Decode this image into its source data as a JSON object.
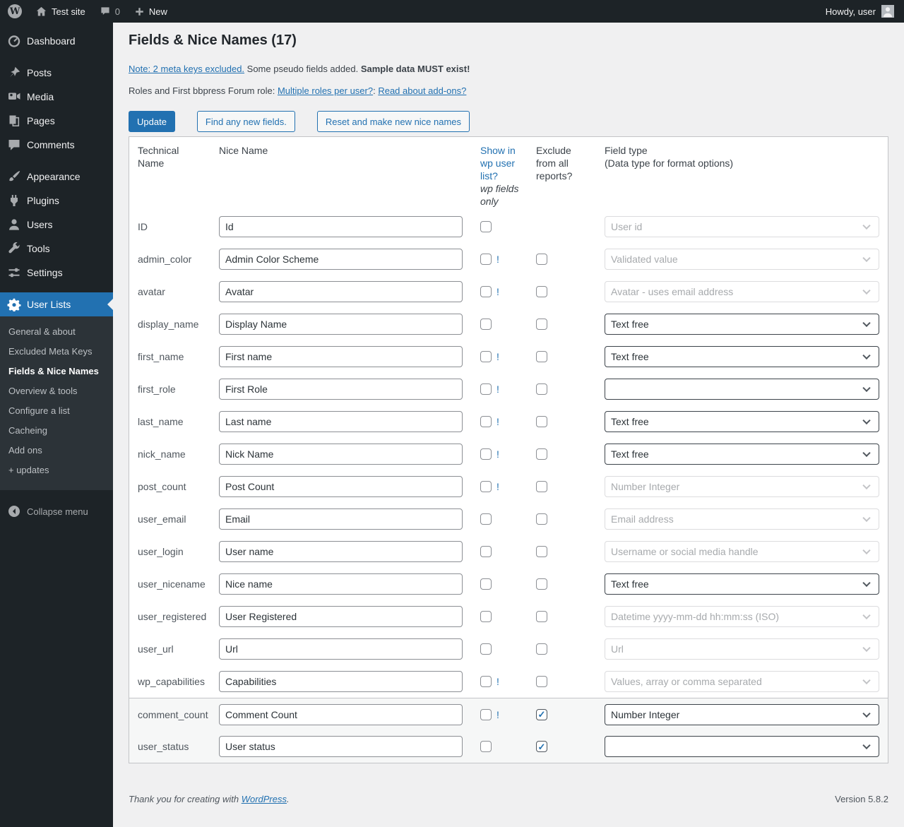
{
  "colors": {
    "accent": "#2271b1",
    "sidebar_bg": "#1d2327",
    "submenu_bg": "#2c3338",
    "content_bg": "#f0f0f1",
    "card_border": "#c3c4c7",
    "highlight_row": "#f6f7f7"
  },
  "admin_bar": {
    "site_name": "Test site",
    "comment_count": "0",
    "new_label": "New",
    "howdy": "Howdy, user",
    "logo_letter": "W"
  },
  "sidebar": {
    "items": [
      {
        "label": "Dashboard",
        "icon": "dashboard-icon",
        "group_break": false
      },
      {
        "label": "Posts",
        "icon": "pin-icon",
        "group_break": true
      },
      {
        "label": "Media",
        "icon": "media-icon",
        "group_break": false
      },
      {
        "label": "Pages",
        "icon": "pages-icon",
        "group_break": false
      },
      {
        "label": "Comments",
        "icon": "comment-icon",
        "group_break": false
      },
      {
        "label": "Appearance",
        "icon": "brush-icon",
        "group_break": true
      },
      {
        "label": "Plugins",
        "icon": "plug-icon",
        "group_break": false
      },
      {
        "label": "Users",
        "icon": "user-icon",
        "group_break": false
      },
      {
        "label": "Tools",
        "icon": "wrench-icon",
        "group_break": false
      },
      {
        "label": "Settings",
        "icon": "sliders-icon",
        "group_break": false
      },
      {
        "label": "User Lists",
        "icon": "gear-icon",
        "group_break": true,
        "active": true
      }
    ],
    "submenu": [
      {
        "label": "General & about",
        "current": false
      },
      {
        "label": "Excluded Meta Keys",
        "current": false
      },
      {
        "label": "Fields & Nice Names",
        "current": true
      },
      {
        "label": "Overview & tools",
        "current": false
      },
      {
        "label": "Configure a list",
        "current": false
      },
      {
        "label": "Cacheing",
        "current": false
      },
      {
        "label": "Add ons",
        "current": false
      },
      {
        "label": "+ updates",
        "current": false
      }
    ],
    "collapse_label": "Collapse menu"
  },
  "main": {
    "title": "Fields & Nice Names (17)",
    "note": {
      "link": "Note: 2 meta keys excluded.",
      "middle": " Some pseudo fields added. ",
      "bold": "Sample data MUST exist!"
    },
    "roles_line": {
      "prefix": "Roles and First bbpress Forum role: ",
      "link1": "Multiple roles per user?",
      "separator": ": ",
      "link2": "Read about add-ons?"
    },
    "buttons": {
      "update": "Update",
      "find": "Find any new fields.",
      "reset": "Reset and make new nice names"
    },
    "table": {
      "required_mark": "!",
      "headers": {
        "technical": "Technical Name",
        "nice": "Nice Name",
        "show_link": "Show in wp user list?",
        "show_note": "wp fields only",
        "exclude": "Exclude from all reports?",
        "field_type_line1": "Field type",
        "field_type_line2": "(Data type for format options)"
      },
      "rows": [
        {
          "technical": "ID",
          "nice": "Id",
          "bang": false,
          "exclude": false,
          "exclude_checked": false,
          "field_type": "User id",
          "field_enabled": false,
          "highlight": false
        },
        {
          "technical": "admin_color",
          "nice": "Admin Color Scheme",
          "bang": true,
          "exclude": true,
          "exclude_checked": false,
          "field_type": "Validated value",
          "field_enabled": false,
          "highlight": false
        },
        {
          "technical": "avatar",
          "nice": "Avatar",
          "bang": true,
          "exclude": true,
          "exclude_checked": false,
          "field_type": "Avatar - uses email address",
          "field_enabled": false,
          "highlight": false
        },
        {
          "technical": "display_name",
          "nice": "Display Name",
          "bang": false,
          "exclude": true,
          "exclude_checked": false,
          "field_type": "Text free",
          "field_enabled": true,
          "highlight": false
        },
        {
          "technical": "first_name",
          "nice": "First name",
          "bang": true,
          "exclude": true,
          "exclude_checked": false,
          "field_type": "Text free",
          "field_enabled": true,
          "highlight": false
        },
        {
          "technical": "first_role",
          "nice": "First Role",
          "bang": true,
          "exclude": true,
          "exclude_checked": false,
          "field_type": "",
          "field_enabled": true,
          "highlight": false
        },
        {
          "technical": "last_name",
          "nice": "Last name",
          "bang": true,
          "exclude": true,
          "exclude_checked": false,
          "field_type": "Text free",
          "field_enabled": true,
          "highlight": false
        },
        {
          "technical": "nick_name",
          "nice": "Nick Name",
          "bang": true,
          "exclude": true,
          "exclude_checked": false,
          "field_type": "Text free",
          "field_enabled": true,
          "highlight": false
        },
        {
          "technical": "post_count",
          "nice": "Post Count",
          "bang": true,
          "exclude": true,
          "exclude_checked": false,
          "field_type": "Number Integer",
          "field_enabled": false,
          "highlight": false
        },
        {
          "technical": "user_email",
          "nice": "Email",
          "bang": false,
          "exclude": true,
          "exclude_checked": false,
          "field_type": "Email address",
          "field_enabled": false,
          "highlight": false
        },
        {
          "technical": "user_login",
          "nice": "User name",
          "bang": false,
          "exclude": true,
          "exclude_checked": false,
          "field_type": "Username or social media handle",
          "field_enabled": false,
          "highlight": false
        },
        {
          "technical": "user_nicename",
          "nice": "Nice name",
          "bang": false,
          "exclude": true,
          "exclude_checked": false,
          "field_type": "Text free",
          "field_enabled": true,
          "highlight": false
        },
        {
          "technical": "user_registered",
          "nice": "User Registered",
          "bang": false,
          "exclude": true,
          "exclude_checked": false,
          "field_type": "Datetime yyyy-mm-dd hh:mm:ss (ISO)",
          "field_enabled": false,
          "highlight": false
        },
        {
          "technical": "user_url",
          "nice": "Url",
          "bang": false,
          "exclude": true,
          "exclude_checked": false,
          "field_type": "Url",
          "field_enabled": false,
          "highlight": false
        },
        {
          "technical": "wp_capabilities",
          "nice": "Capabilities",
          "bang": true,
          "exclude": true,
          "exclude_checked": false,
          "field_type": "Values, array or comma separated",
          "field_enabled": false,
          "highlight": false
        },
        {
          "technical": "comment_count",
          "nice": "Comment Count",
          "bang": true,
          "exclude": true,
          "exclude_checked": true,
          "field_type": "Number Integer",
          "field_enabled": true,
          "highlight": true
        },
        {
          "technical": "user_status",
          "nice": "User status",
          "bang": false,
          "exclude": true,
          "exclude_checked": true,
          "field_type": "",
          "field_enabled": true,
          "highlight": true
        }
      ]
    }
  },
  "footer": {
    "thanks_prefix": "Thank you for creating with ",
    "wordpress_link": "WordPress",
    "suffix": ".",
    "version": "Version 5.8.2"
  }
}
